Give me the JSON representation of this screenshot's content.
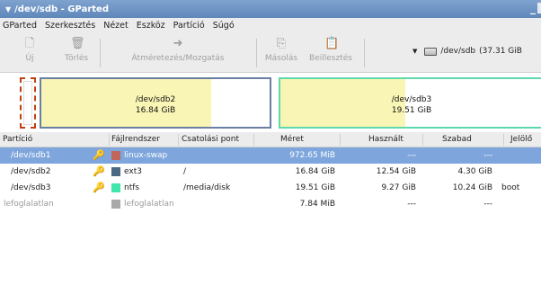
{
  "window": {
    "title": "/dev/sdb - GParted"
  },
  "menu": [
    "GParted",
    "Szerkesztés",
    "Nézet",
    "Eszköz",
    "Partíció",
    "Súgó"
  ],
  "toolbar": {
    "new": "Új",
    "delete": "Törlés",
    "resize": "Átméretezés/Mozgatás",
    "copy": "Másolás",
    "paste": "Beillesztés",
    "device": "/dev/sdb",
    "device_size": "(37.31 GiB"
  },
  "diskmap": {
    "sdb2": {
      "name": "/dev/sdb2",
      "size": "16.84 GiB",
      "used_fraction": 0.745
    },
    "sdb3": {
      "name": "/dev/sdb3",
      "size": "19.51 GiB",
      "used_fraction": 0.475
    }
  },
  "columns": [
    "Partíció",
    "Fájlrendszer",
    "Csatolási pont",
    "Méret",
    "Használt",
    "Szabad",
    "Jelölő"
  ],
  "rows": [
    {
      "partition": "/dev/sdb1",
      "fs": "linux-swap",
      "mount": "",
      "size": "972.65 MiB",
      "used": "---",
      "free": "---",
      "flags": "",
      "fs_color": "#c1665a",
      "selected": true
    },
    {
      "partition": "/dev/sdb2",
      "fs": "ext3",
      "mount": "/",
      "size": "16.84 GiB",
      "used": "12.54 GiB",
      "free": "4.30 GiB",
      "flags": "",
      "fs_color": "#4b6983",
      "selected": false
    },
    {
      "partition": "/dev/sdb3",
      "fs": "ntfs",
      "mount": "/media/disk",
      "size": "19.51 GiB",
      "used": "9.27 GiB",
      "free": "10.24 GiB",
      "flags": "boot",
      "fs_color": "#42e5ac",
      "selected": false
    },
    {
      "partition": "lefoglalatlan",
      "fs": "lefoglalatlan",
      "mount": "",
      "size": "7.84 MiB",
      "used": "---",
      "free": "---",
      "flags": "",
      "fs_color": "#a9a9a9",
      "selected": false
    }
  ]
}
